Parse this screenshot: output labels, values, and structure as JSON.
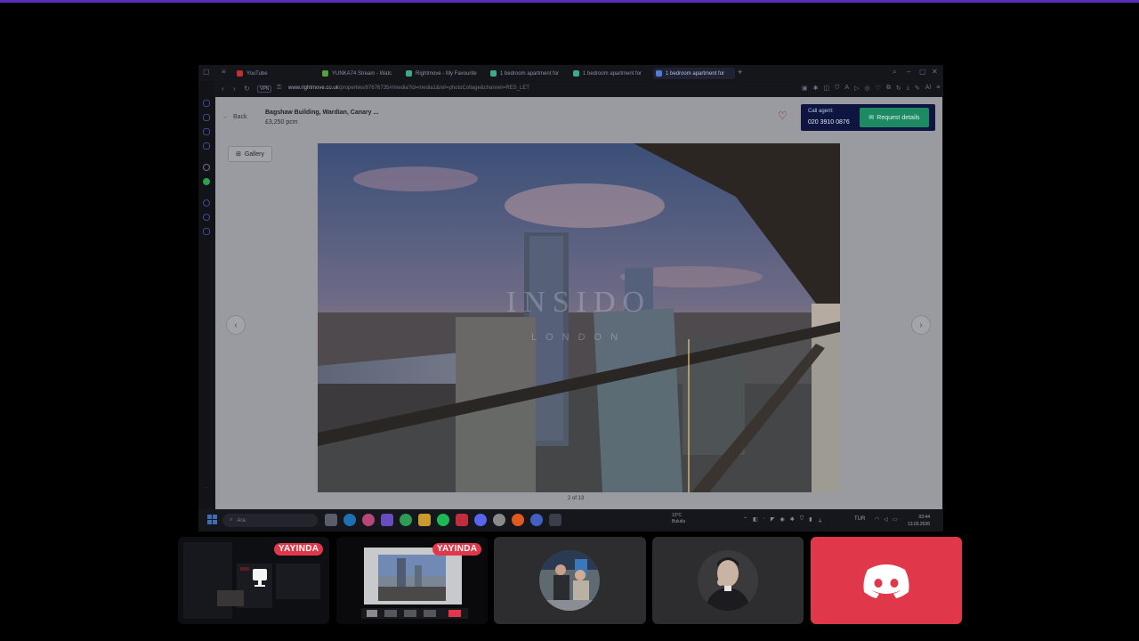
{
  "browser": {
    "tabs": [
      {
        "label": "YouTube",
        "favicon_color": "#c4302b"
      },
      {
        "label": "YUNKA74 Stream - Watc",
        "favicon_color": "#53a23b"
      },
      {
        "label": "Rightmove - My Favourite",
        "favicon_color": "#3fa98d"
      },
      {
        "label": "1 bedroom apartment for",
        "favicon_color": "#3fa98d"
      },
      {
        "label": "1 bedroom apartment for",
        "favicon_color": "#3fa98d"
      },
      {
        "label": "1 bedroom apartment for",
        "favicon_color": "#4f7cd8",
        "active": true
      }
    ],
    "vpn_label": "VPN",
    "url_domain": "www.rightmove.co.uk",
    "url_path": "/properties/87676735#/media?id=media1&ref=photoCollage&channel=RES_LET",
    "ai_label": "AI"
  },
  "listing": {
    "back_label": "Back",
    "title": "Bagshaw Building, Wardian, Canary ...",
    "price": "£3,250 pcm",
    "call_agent_label": "Call agent:",
    "phone": "020 3910 0876",
    "request_label": "Request details",
    "gallery_label": "Gallery",
    "counter": "2 of 13",
    "watermark_top": "INSIDO",
    "watermark_bottom": "LONDON"
  },
  "taskbar": {
    "search_placeholder": "Ara",
    "weather_temp": "13°C",
    "weather_desc": "Bulutlu",
    "language": "TUR",
    "time": "03:44",
    "date": "13.03.2026"
  },
  "tiles": [
    {
      "live_label": "YAYINDA"
    },
    {
      "live_label": "YAYINDA"
    }
  ],
  "colors": {
    "live_badge": "#e0384a",
    "discord": "#e0384a",
    "agent_box": "#0d1540",
    "request_button": "#1d8a64"
  }
}
